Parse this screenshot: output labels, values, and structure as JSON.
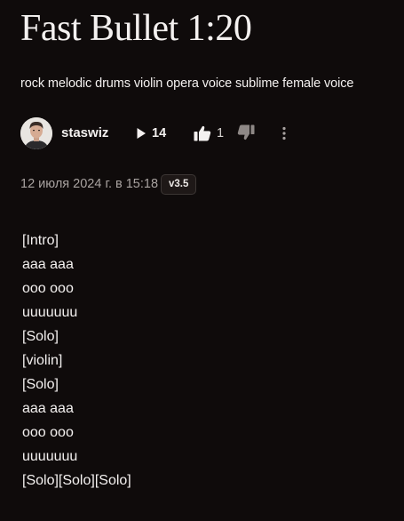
{
  "song": {
    "title": "Fast Bullet 1:20",
    "tags": "rock melodic drums violin opera voice sublime female voice"
  },
  "author": {
    "username": "staswiz"
  },
  "stats": {
    "plays": "14",
    "likes": "1"
  },
  "icons": {
    "play": "play-icon",
    "like": "thumbs-up-icon",
    "dislike": "thumbs-down-icon",
    "more": "vertical-ellipsis-icon"
  },
  "created": "12 июля 2024 г. в 15:18",
  "model_version": "v3.5",
  "lyrics": [
    "[Intro]",
    "aaa aaa",
    "ooo ooo",
    "uuuuuuu",
    "[Solo]",
    "[violin]",
    "[Solo]",
    "aaa aaa",
    "ooo ooo",
    "uuuuuuu",
    "[Solo][Solo][Solo]"
  ],
  "colors": {
    "background": "#0f0b0b",
    "text": "#f4f1f0",
    "muted": "#a9a3a1"
  }
}
